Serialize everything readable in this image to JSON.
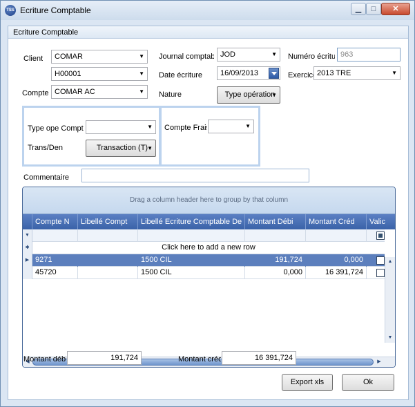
{
  "window": {
    "title": "Ecriture Comptable",
    "icon_text": "TSS",
    "controls": {
      "minimize": "▁",
      "maximize": "□",
      "close": "✕"
    }
  },
  "panel": {
    "header": "Ecriture Comptable"
  },
  "form": {
    "client_label": "Client",
    "client_name": "COMAR",
    "client_code": "H00001",
    "compte_label": "Compte",
    "compte_value": "COMAR AC",
    "journal_label": "Journal comptab",
    "journal_value": "JOD",
    "date_label": "Date écriture",
    "date_value": "16/09/2013",
    "nature_label": "Nature",
    "nature_value": "Type opération",
    "numero_label": "Numéro écritu",
    "numero_value": "963",
    "exercice_label": "Exercice",
    "exercice_value": "2013 TRE",
    "type_ope_label": "Type ope Compt",
    "type_ope_value": "",
    "trans_label": "Trans/Den",
    "trans_value": "Transaction (T)",
    "compte_frais_label": "Compte Frais",
    "compte_frais_value": "",
    "commentaire_label": "Commentaire",
    "commentaire_value": ""
  },
  "grid": {
    "group_hint": "Drag a column header here to group by that column",
    "columns": [
      "Compte N",
      "Libellé Compt",
      "Libellé Ecriture Comptable De",
      "Montant Débi",
      "Montant Créd",
      "Valic"
    ],
    "new_row_text": "Click here to add a new row",
    "rows": [
      {
        "compte": "9271",
        "libelle_compte": "",
        "libelle_ecriture": "1500 CIL",
        "debit": "191,724",
        "credit": "0,000",
        "valide": false,
        "selected": true
      },
      {
        "compte": "45720",
        "libelle_compte": "",
        "libelle_ecriture": "1500 CIL",
        "debit": "0,000",
        "credit": "16 391,724",
        "valide": false,
        "selected": false
      }
    ]
  },
  "totals": {
    "debit_label": "Montant débi",
    "debit_value": "191,724",
    "credit_label": "Montant créd",
    "credit_value": "16 391,724"
  },
  "buttons": {
    "export": "Export xls",
    "ok": "Ok"
  }
}
